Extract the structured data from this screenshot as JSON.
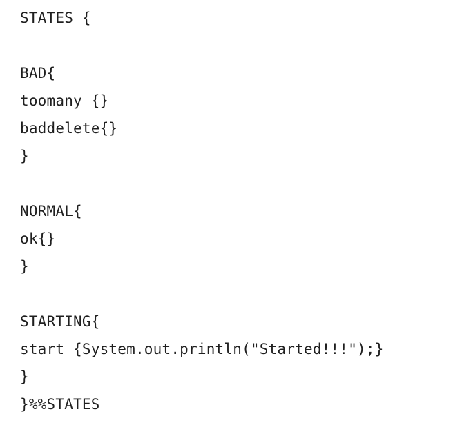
{
  "code": {
    "lines": [
      "STATES {",
      "",
      "BAD{",
      "toomany {}",
      "baddelete{}",
      "}",
      "",
      "NORMAL{",
      "ok{}",
      "}",
      "",
      "STARTING{",
      "start {System.out.println(\"Started!!!\");}",
      "}",
      "}%%STATES"
    ]
  }
}
